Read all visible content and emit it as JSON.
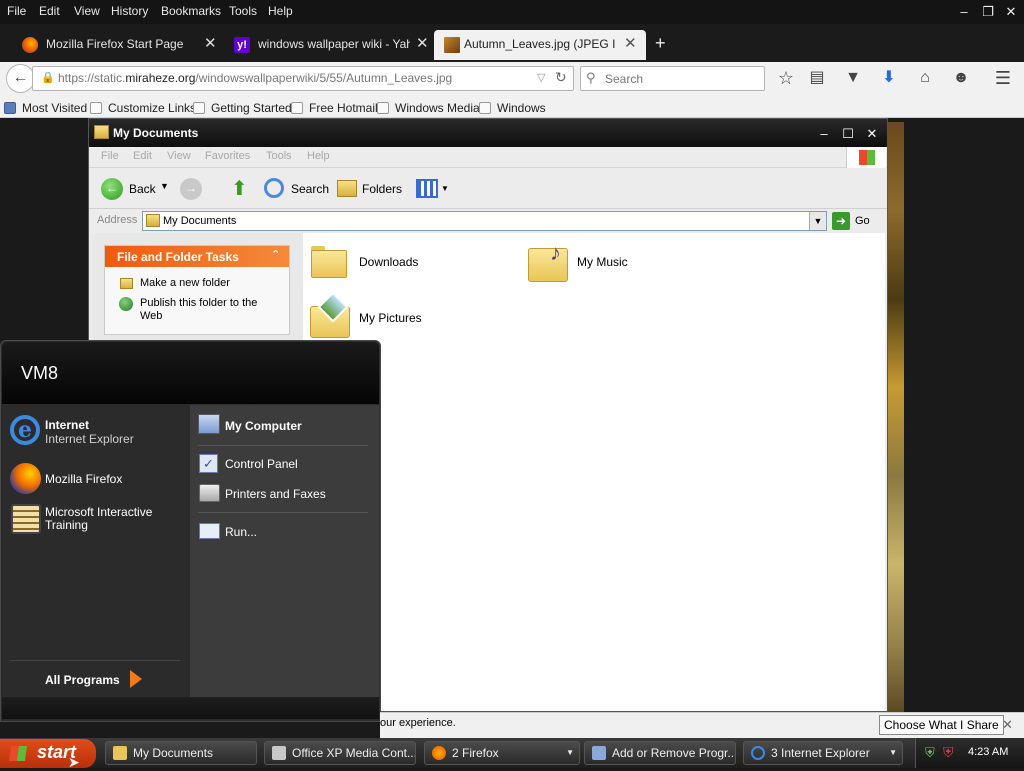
{
  "firefox": {
    "menu": [
      "File",
      "Edit",
      "View",
      "History",
      "Bookmarks",
      "Tools",
      "Help"
    ],
    "tabs": [
      {
        "label": "Mozilla Firefox Start Page",
        "icon": "firefox-icon"
      },
      {
        "label": "windows wallpaper wiki - Yaho...",
        "icon": "yahoo-icon"
      },
      {
        "label": "Autumn_Leaves.jpg (JPEG Im...",
        "icon": "image-icon"
      }
    ],
    "url_prefix": "https://static.",
    "url_domain": "miraheze.org",
    "url_path": "/windowswallpaperwiki/5/55/Autumn_Leaves.jpg",
    "search_placeholder": "Search",
    "bookmarks": [
      "Most Visited",
      "Customize Links",
      "Getting Started",
      "Free Hotmail",
      "Windows Media",
      "Windows"
    ],
    "status_text": "our experience.",
    "choose_share": "Choose What I Share"
  },
  "explorer": {
    "title": "My Documents",
    "menu": [
      "File",
      "Edit",
      "View",
      "Favorites",
      "Tools",
      "Help"
    ],
    "toolbar": {
      "back": "Back",
      "search": "Search",
      "folders": "Folders"
    },
    "address_label": "Address",
    "address_value": "My Documents",
    "go": "Go",
    "tasks_title": "File and Folder Tasks",
    "tasks": [
      "Make a new folder",
      "Publish this folder to the Web"
    ],
    "items": [
      "Downloads",
      "My Music",
      "My Pictures"
    ]
  },
  "start_menu": {
    "user": "VM8",
    "internet_title": "Internet",
    "internet_sub": "Internet Explorer",
    "firefox": "Mozilla Firefox",
    "training": "Microsoft Interactive Training",
    "all_programs": "All Programs",
    "right": [
      "My Computer",
      "Control Panel",
      "Printers and Faxes",
      "Run..."
    ]
  },
  "taskbar": {
    "start": "start",
    "buttons": [
      "My Documents",
      "Office XP Media Cont...",
      "2 Firefox",
      "Add or Remove Progr...",
      "3 Internet Explorer"
    ],
    "clock": "4:23 AM"
  }
}
